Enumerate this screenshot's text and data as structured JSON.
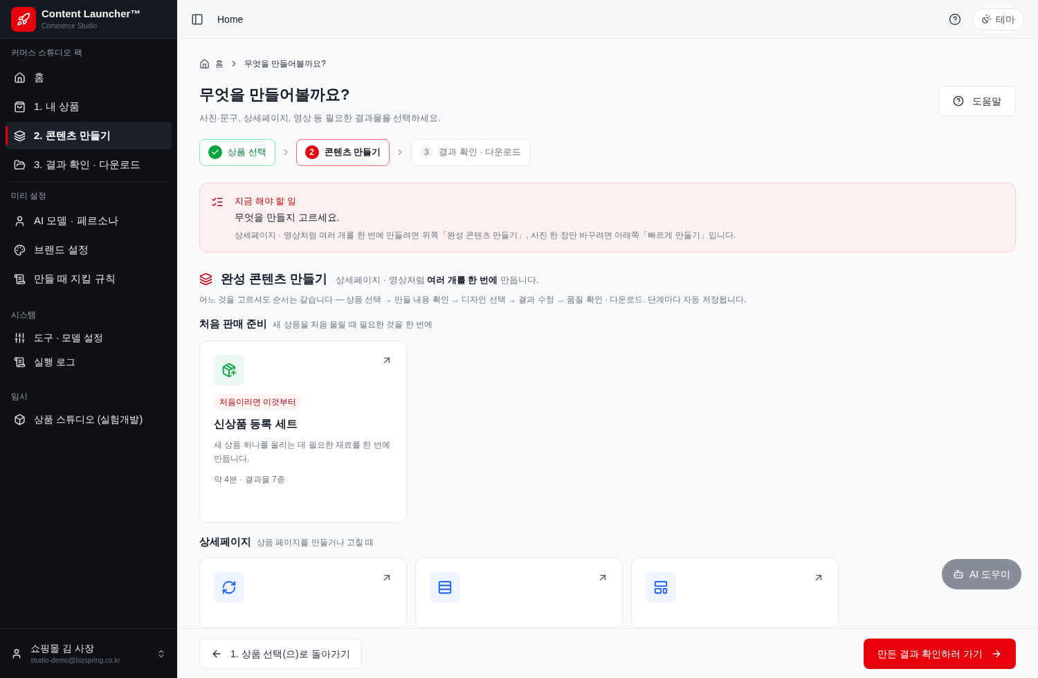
{
  "brand": {
    "name": "Content Launcher™",
    "subtitle": "Commerce Studio"
  },
  "sidebar": {
    "sections": [
      {
        "title": "커머스 스튜디오 팩",
        "items": [
          {
            "label": "홈",
            "selected": false
          },
          {
            "label": "1. 내 상품",
            "selected": false
          },
          {
            "label": "2. 콘텐츠 만들기",
            "selected": true
          },
          {
            "label": "3. 결과 확인 · 다운로드",
            "selected": false
          }
        ]
      },
      {
        "title": "미리 설정",
        "items": [
          {
            "label": "AI 모델 · 페르소나",
            "selected": false
          },
          {
            "label": "브랜드 설정",
            "selected": false
          },
          {
            "label": "만들 때 지킬 규칙",
            "selected": false
          }
        ]
      },
      {
        "title": "시스템",
        "items": [
          {
            "label": "도구 · 모델 설정",
            "selected": false
          },
          {
            "label": "실행 로그",
            "selected": false
          }
        ]
      },
      {
        "title": "임시",
        "items": [
          {
            "label": "상품 스튜디오 (실험개발)",
            "selected": false
          }
        ]
      }
    ],
    "user": {
      "name": "쇼핑몰 김 사장",
      "email": "studio-demo@bizspring.co.kr"
    }
  },
  "header": {
    "title": "Home",
    "theme_button": "테마"
  },
  "breadcrumb": [
    "홈",
    "무엇을 만들어볼까요?"
  ],
  "page": {
    "title": "무엇을 만들어볼까요?",
    "subtitle": "사진·문구, 상세페이지, 영상 등 필요한 결과물을 선택하세요.",
    "help_button": "도움말"
  },
  "steps": [
    {
      "label": "상품 선택",
      "kind": "done"
    },
    {
      "number": "2",
      "label": "콘텐츠 만들기",
      "kind": "current"
    },
    {
      "number": "3",
      "label": "결과 확인 · 다운로드",
      "kind": "todo"
    }
  ],
  "todo": {
    "label": "지금 해야 할 일",
    "title": "무엇을 만들지 고르세요.",
    "text": "상세페이지 · 영상처럼 여러 개를 한 번에 만들려면 위쪽「완성 콘텐츠 만들기」, 사진 한 장만 바꾸려면 아래쪽「빠르게 만들기」입니다."
  },
  "section": {
    "title": "완성 콘텐츠 만들기",
    "description": "상세페이지 · 영상처럼 **여러 개를 한 번에** 만듭니다.",
    "note": "어느 것을 고르셔도 순서는 같습니다 — 상품 선택 → 만들 내용 확인 → 디자인 선택 → 결과 수정 → 품질 확인 · 다운로드. 단계마다 자동 저장됩니다."
  },
  "groups": [
    {
      "title": "처음 판매 준비",
      "description": "새 상품을 처음 올릴 때 필요한 것을 한 번에",
      "cards": [
        {
          "color": "#e8f7ef",
          "badge": "처음이라면 이것부터",
          "title": "신상품 등록 세트",
          "text": "새 상품 하나를 올리는 데 필요한 재료를 한 번에 만듭니다.",
          "meta": "약 4분 · 결과물 7종"
        }
      ]
    },
    {
      "title": "상세페이지",
      "description": "상품 페이지를 만들거나 고칠 때",
      "cards": [
        {
          "color": "#eef4ff"
        },
        {
          "color": "#eef4ff"
        },
        {
          "color": "#eef4ff"
        }
      ]
    }
  ],
  "footer": {
    "back_button": "1. 상품 선택(으)로 돌아가기",
    "next_button": "만든 결과 확인하러 가기"
  },
  "assistant_button": "AI 도우미"
}
